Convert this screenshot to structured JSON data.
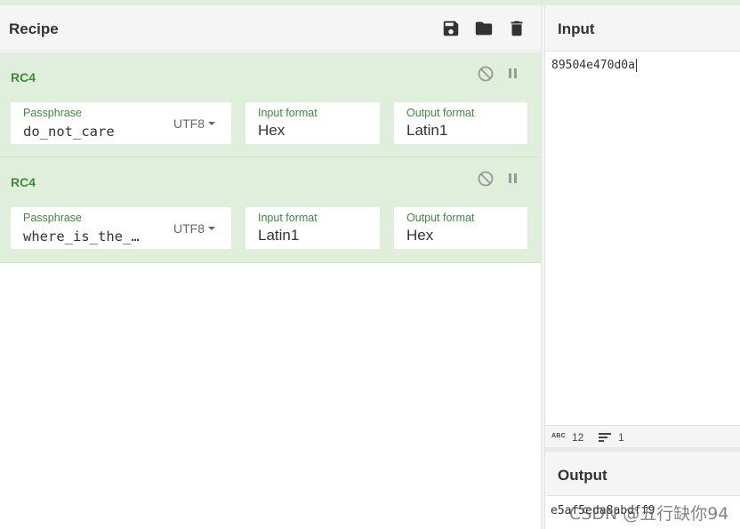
{
  "recipe": {
    "title": "Recipe",
    "icons": [
      "save-icon",
      "folder-icon",
      "trash-icon"
    ]
  },
  "operations": [
    {
      "name": "RC4",
      "passphrase_label": "Passphrase",
      "passphrase_value": "do_not_care",
      "encoding": "UTF8",
      "input_format_label": "Input format",
      "input_format_value": "Hex",
      "output_format_label": "Output format",
      "output_format_value": "Latin1"
    },
    {
      "name": "RC4",
      "passphrase_label": "Passphrase",
      "passphrase_value": "where_is_the_…",
      "encoding": "UTF8",
      "input_format_label": "Input format",
      "input_format_value": "Latin1",
      "output_format_label": "Output format",
      "output_format_value": "Hex"
    }
  ],
  "input": {
    "title": "Input",
    "text": "89504e470d0a",
    "status_abc": "ABC",
    "length": "12",
    "lines": "1"
  },
  "output": {
    "title": "Output",
    "text": "e5af5eda8abdff9"
  },
  "watermark": "CSDN @五行缺你94",
  "colors": {
    "op_background": "#dfefdb",
    "op_accent": "#3f8a3c",
    "header_background": "#f5f5f5"
  }
}
